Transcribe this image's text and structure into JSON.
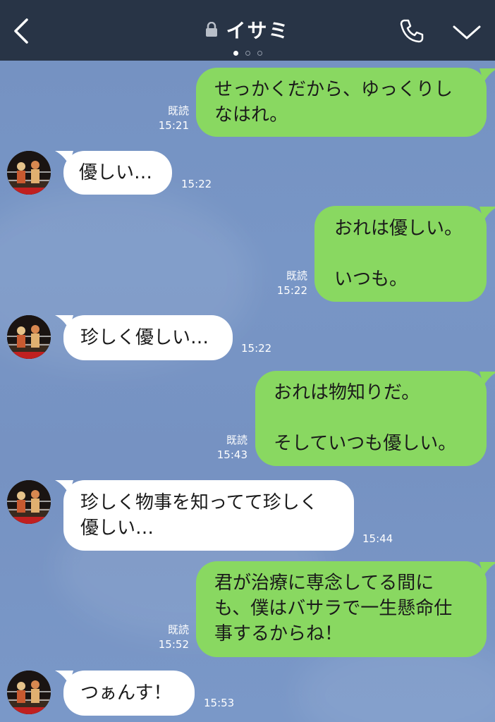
{
  "header": {
    "title": "イサミ",
    "icons": {
      "back": "chevron-left-icon",
      "lock": "lock-icon",
      "call": "phone-icon",
      "menu": "chevron-down-icon"
    },
    "page_dots": 3,
    "active_dot": 1
  },
  "colors": {
    "header_bg": "#283446",
    "chat_bg": "#7592c2",
    "sent_bubble": "#89d861",
    "recv_bubble": "#ffffff"
  },
  "messages": [
    {
      "from": "me",
      "lines": [
        "せっかくだから、ゆっくりし",
        "なはれ。"
      ],
      "read": "既読",
      "time": "15:21"
    },
    {
      "from": "them",
      "lines": [
        "優しい…"
      ],
      "time": "15:22"
    },
    {
      "from": "me",
      "lines": [
        "おれは優しい。",
        "",
        "いつも。"
      ],
      "read": "既読",
      "time": "15:22"
    },
    {
      "from": "them",
      "lines": [
        "珍しく優しい…"
      ],
      "time": "15:22"
    },
    {
      "from": "me",
      "lines": [
        "おれは物知りだ。",
        "",
        "そしていつも優しい。"
      ],
      "read": "既読",
      "time": "15:43"
    },
    {
      "from": "them",
      "lines": [
        "珍しく物事を知ってて珍しく",
        "優しい…"
      ],
      "time": "15:44"
    },
    {
      "from": "me",
      "lines": [
        "君が治療に専念してる間に",
        "も、僕はバサラで一生懸命仕",
        "事するからね！"
      ],
      "read": "既読",
      "time": "15:52"
    },
    {
      "from": "them",
      "lines": [
        "つぁんす！"
      ],
      "time": "15:53"
    }
  ]
}
